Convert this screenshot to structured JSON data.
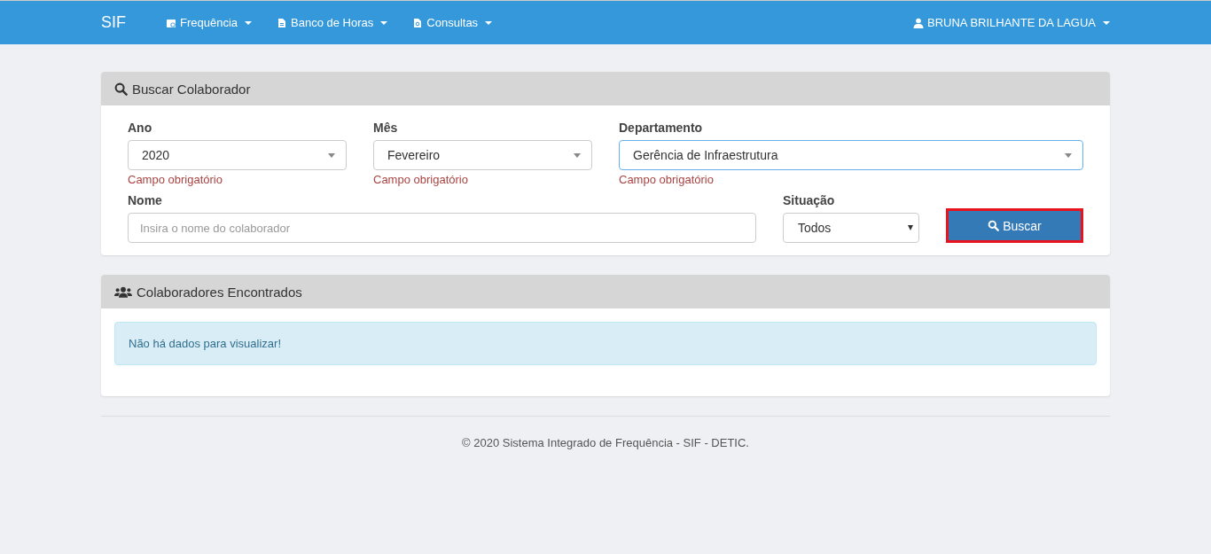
{
  "navbar": {
    "brand": "SIF",
    "menus": [
      {
        "label": "Frequência"
      },
      {
        "label": "Banco de Horas"
      },
      {
        "label": "Consultas"
      }
    ],
    "user": "BRUNA BRILHANTE DA LAGUA"
  },
  "search_panel": {
    "title": "Buscar Colaborador",
    "selects": [
      {
        "label": "Ano",
        "value": "2020",
        "error": "Campo obrigatório",
        "focused": false
      },
      {
        "label": "Mês",
        "value": "Fevereiro",
        "error": "Campo obrigatório",
        "focused": false
      },
      {
        "label": "Departamento",
        "value": "Gerência de Infraestrutura",
        "error": "Campo obrigatório",
        "focused": true
      }
    ],
    "name_field": {
      "label": "Nome",
      "placeholder": "Insira o nome do colaborador"
    },
    "status_field": {
      "label": "Situação",
      "value": "Todos"
    },
    "search_button": {
      "label": "Buscar",
      "highlighted": true
    }
  },
  "results_panel": {
    "title": "Colaboradores Encontrados",
    "message": "Não há dados para visualizar!"
  },
  "footer": "© 2020 Sistema Integrado de Frequência - SIF - DETIC."
}
